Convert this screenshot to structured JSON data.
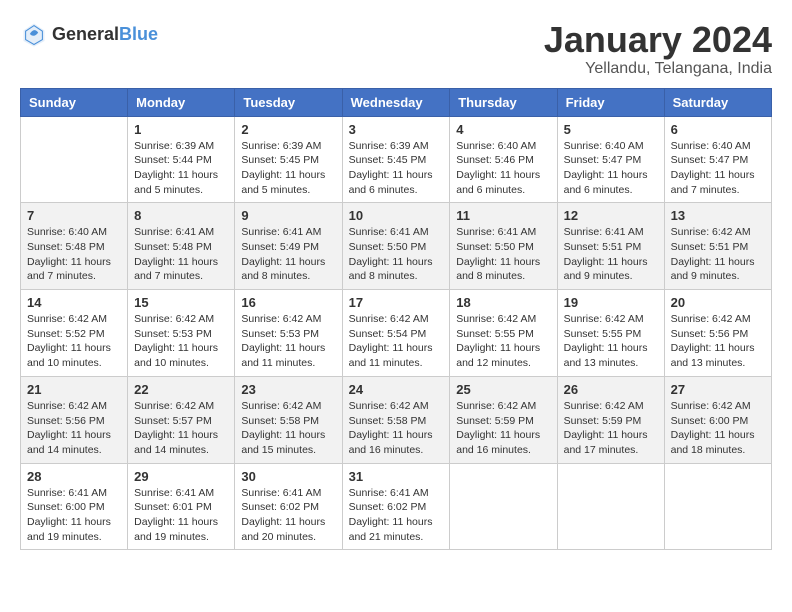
{
  "header": {
    "logo_general": "General",
    "logo_blue": "Blue",
    "month_title": "January 2024",
    "location": "Yellandu, Telangana, India"
  },
  "days_of_week": [
    "Sunday",
    "Monday",
    "Tuesday",
    "Wednesday",
    "Thursday",
    "Friday",
    "Saturday"
  ],
  "weeks": [
    [
      {
        "day": "",
        "sunrise": "",
        "sunset": "",
        "daylight": ""
      },
      {
        "day": "1",
        "sunrise": "Sunrise: 6:39 AM",
        "sunset": "Sunset: 5:44 PM",
        "daylight": "Daylight: 11 hours and 5 minutes."
      },
      {
        "day": "2",
        "sunrise": "Sunrise: 6:39 AM",
        "sunset": "Sunset: 5:45 PM",
        "daylight": "Daylight: 11 hours and 5 minutes."
      },
      {
        "day": "3",
        "sunrise": "Sunrise: 6:39 AM",
        "sunset": "Sunset: 5:45 PM",
        "daylight": "Daylight: 11 hours and 6 minutes."
      },
      {
        "day": "4",
        "sunrise": "Sunrise: 6:40 AM",
        "sunset": "Sunset: 5:46 PM",
        "daylight": "Daylight: 11 hours and 6 minutes."
      },
      {
        "day": "5",
        "sunrise": "Sunrise: 6:40 AM",
        "sunset": "Sunset: 5:47 PM",
        "daylight": "Daylight: 11 hours and 6 minutes."
      },
      {
        "day": "6",
        "sunrise": "Sunrise: 6:40 AM",
        "sunset": "Sunset: 5:47 PM",
        "daylight": "Daylight: 11 hours and 7 minutes."
      }
    ],
    [
      {
        "day": "7",
        "sunrise": "Sunrise: 6:40 AM",
        "sunset": "Sunset: 5:48 PM",
        "daylight": "Daylight: 11 hours and 7 minutes."
      },
      {
        "day": "8",
        "sunrise": "Sunrise: 6:41 AM",
        "sunset": "Sunset: 5:48 PM",
        "daylight": "Daylight: 11 hours and 7 minutes."
      },
      {
        "day": "9",
        "sunrise": "Sunrise: 6:41 AM",
        "sunset": "Sunset: 5:49 PM",
        "daylight": "Daylight: 11 hours and 8 minutes."
      },
      {
        "day": "10",
        "sunrise": "Sunrise: 6:41 AM",
        "sunset": "Sunset: 5:50 PM",
        "daylight": "Daylight: 11 hours and 8 minutes."
      },
      {
        "day": "11",
        "sunrise": "Sunrise: 6:41 AM",
        "sunset": "Sunset: 5:50 PM",
        "daylight": "Daylight: 11 hours and 8 minutes."
      },
      {
        "day": "12",
        "sunrise": "Sunrise: 6:41 AM",
        "sunset": "Sunset: 5:51 PM",
        "daylight": "Daylight: 11 hours and 9 minutes."
      },
      {
        "day": "13",
        "sunrise": "Sunrise: 6:42 AM",
        "sunset": "Sunset: 5:51 PM",
        "daylight": "Daylight: 11 hours and 9 minutes."
      }
    ],
    [
      {
        "day": "14",
        "sunrise": "Sunrise: 6:42 AM",
        "sunset": "Sunset: 5:52 PM",
        "daylight": "Daylight: 11 hours and 10 minutes."
      },
      {
        "day": "15",
        "sunrise": "Sunrise: 6:42 AM",
        "sunset": "Sunset: 5:53 PM",
        "daylight": "Daylight: 11 hours and 10 minutes."
      },
      {
        "day": "16",
        "sunrise": "Sunrise: 6:42 AM",
        "sunset": "Sunset: 5:53 PM",
        "daylight": "Daylight: 11 hours and 11 minutes."
      },
      {
        "day": "17",
        "sunrise": "Sunrise: 6:42 AM",
        "sunset": "Sunset: 5:54 PM",
        "daylight": "Daylight: 11 hours and 11 minutes."
      },
      {
        "day": "18",
        "sunrise": "Sunrise: 6:42 AM",
        "sunset": "Sunset: 5:55 PM",
        "daylight": "Daylight: 11 hours and 12 minutes."
      },
      {
        "day": "19",
        "sunrise": "Sunrise: 6:42 AM",
        "sunset": "Sunset: 5:55 PM",
        "daylight": "Daylight: 11 hours and 13 minutes."
      },
      {
        "day": "20",
        "sunrise": "Sunrise: 6:42 AM",
        "sunset": "Sunset: 5:56 PM",
        "daylight": "Daylight: 11 hours and 13 minutes."
      }
    ],
    [
      {
        "day": "21",
        "sunrise": "Sunrise: 6:42 AM",
        "sunset": "Sunset: 5:56 PM",
        "daylight": "Daylight: 11 hours and 14 minutes."
      },
      {
        "day": "22",
        "sunrise": "Sunrise: 6:42 AM",
        "sunset": "Sunset: 5:57 PM",
        "daylight": "Daylight: 11 hours and 14 minutes."
      },
      {
        "day": "23",
        "sunrise": "Sunrise: 6:42 AM",
        "sunset": "Sunset: 5:58 PM",
        "daylight": "Daylight: 11 hours and 15 minutes."
      },
      {
        "day": "24",
        "sunrise": "Sunrise: 6:42 AM",
        "sunset": "Sunset: 5:58 PM",
        "daylight": "Daylight: 11 hours and 16 minutes."
      },
      {
        "day": "25",
        "sunrise": "Sunrise: 6:42 AM",
        "sunset": "Sunset: 5:59 PM",
        "daylight": "Daylight: 11 hours and 16 minutes."
      },
      {
        "day": "26",
        "sunrise": "Sunrise: 6:42 AM",
        "sunset": "Sunset: 5:59 PM",
        "daylight": "Daylight: 11 hours and 17 minutes."
      },
      {
        "day": "27",
        "sunrise": "Sunrise: 6:42 AM",
        "sunset": "Sunset: 6:00 PM",
        "daylight": "Daylight: 11 hours and 18 minutes."
      }
    ],
    [
      {
        "day": "28",
        "sunrise": "Sunrise: 6:41 AM",
        "sunset": "Sunset: 6:00 PM",
        "daylight": "Daylight: 11 hours and 19 minutes."
      },
      {
        "day": "29",
        "sunrise": "Sunrise: 6:41 AM",
        "sunset": "Sunset: 6:01 PM",
        "daylight": "Daylight: 11 hours and 19 minutes."
      },
      {
        "day": "30",
        "sunrise": "Sunrise: 6:41 AM",
        "sunset": "Sunset: 6:02 PM",
        "daylight": "Daylight: 11 hours and 20 minutes."
      },
      {
        "day": "31",
        "sunrise": "Sunrise: 6:41 AM",
        "sunset": "Sunset: 6:02 PM",
        "daylight": "Daylight: 11 hours and 21 minutes."
      },
      {
        "day": "",
        "sunrise": "",
        "sunset": "",
        "daylight": ""
      },
      {
        "day": "",
        "sunrise": "",
        "sunset": "",
        "daylight": ""
      },
      {
        "day": "",
        "sunrise": "",
        "sunset": "",
        "daylight": ""
      }
    ]
  ]
}
